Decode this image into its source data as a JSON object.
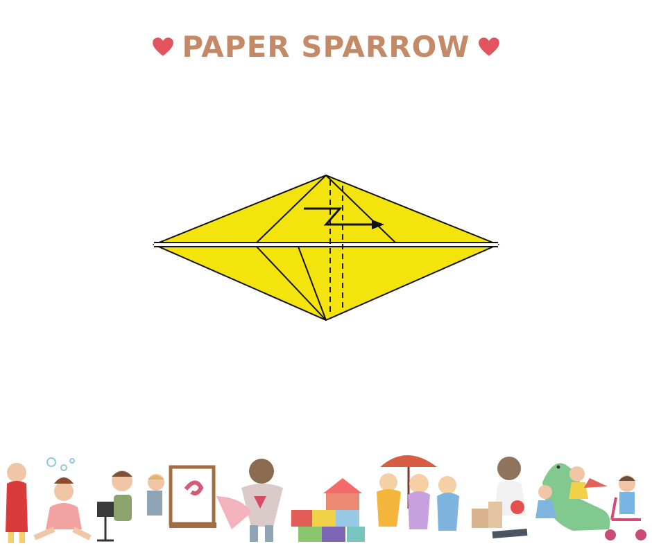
{
  "title": "PAPER SPARROW",
  "colors": {
    "title": "#c48a68",
    "heart": "#e2555f",
    "paper": "#f2e40c",
    "line": "#111111"
  },
  "icons": {
    "left_heart": "heart-icon",
    "right_heart": "heart-icon",
    "fold_arrow": "zigzag-arrow-icon"
  },
  "diagram": {
    "shape": "kite-diamond",
    "fold_type": "inside reverse / pleat fold",
    "dashed_lines": 2
  },
  "footer": {
    "illustration": "children-playing-border"
  }
}
